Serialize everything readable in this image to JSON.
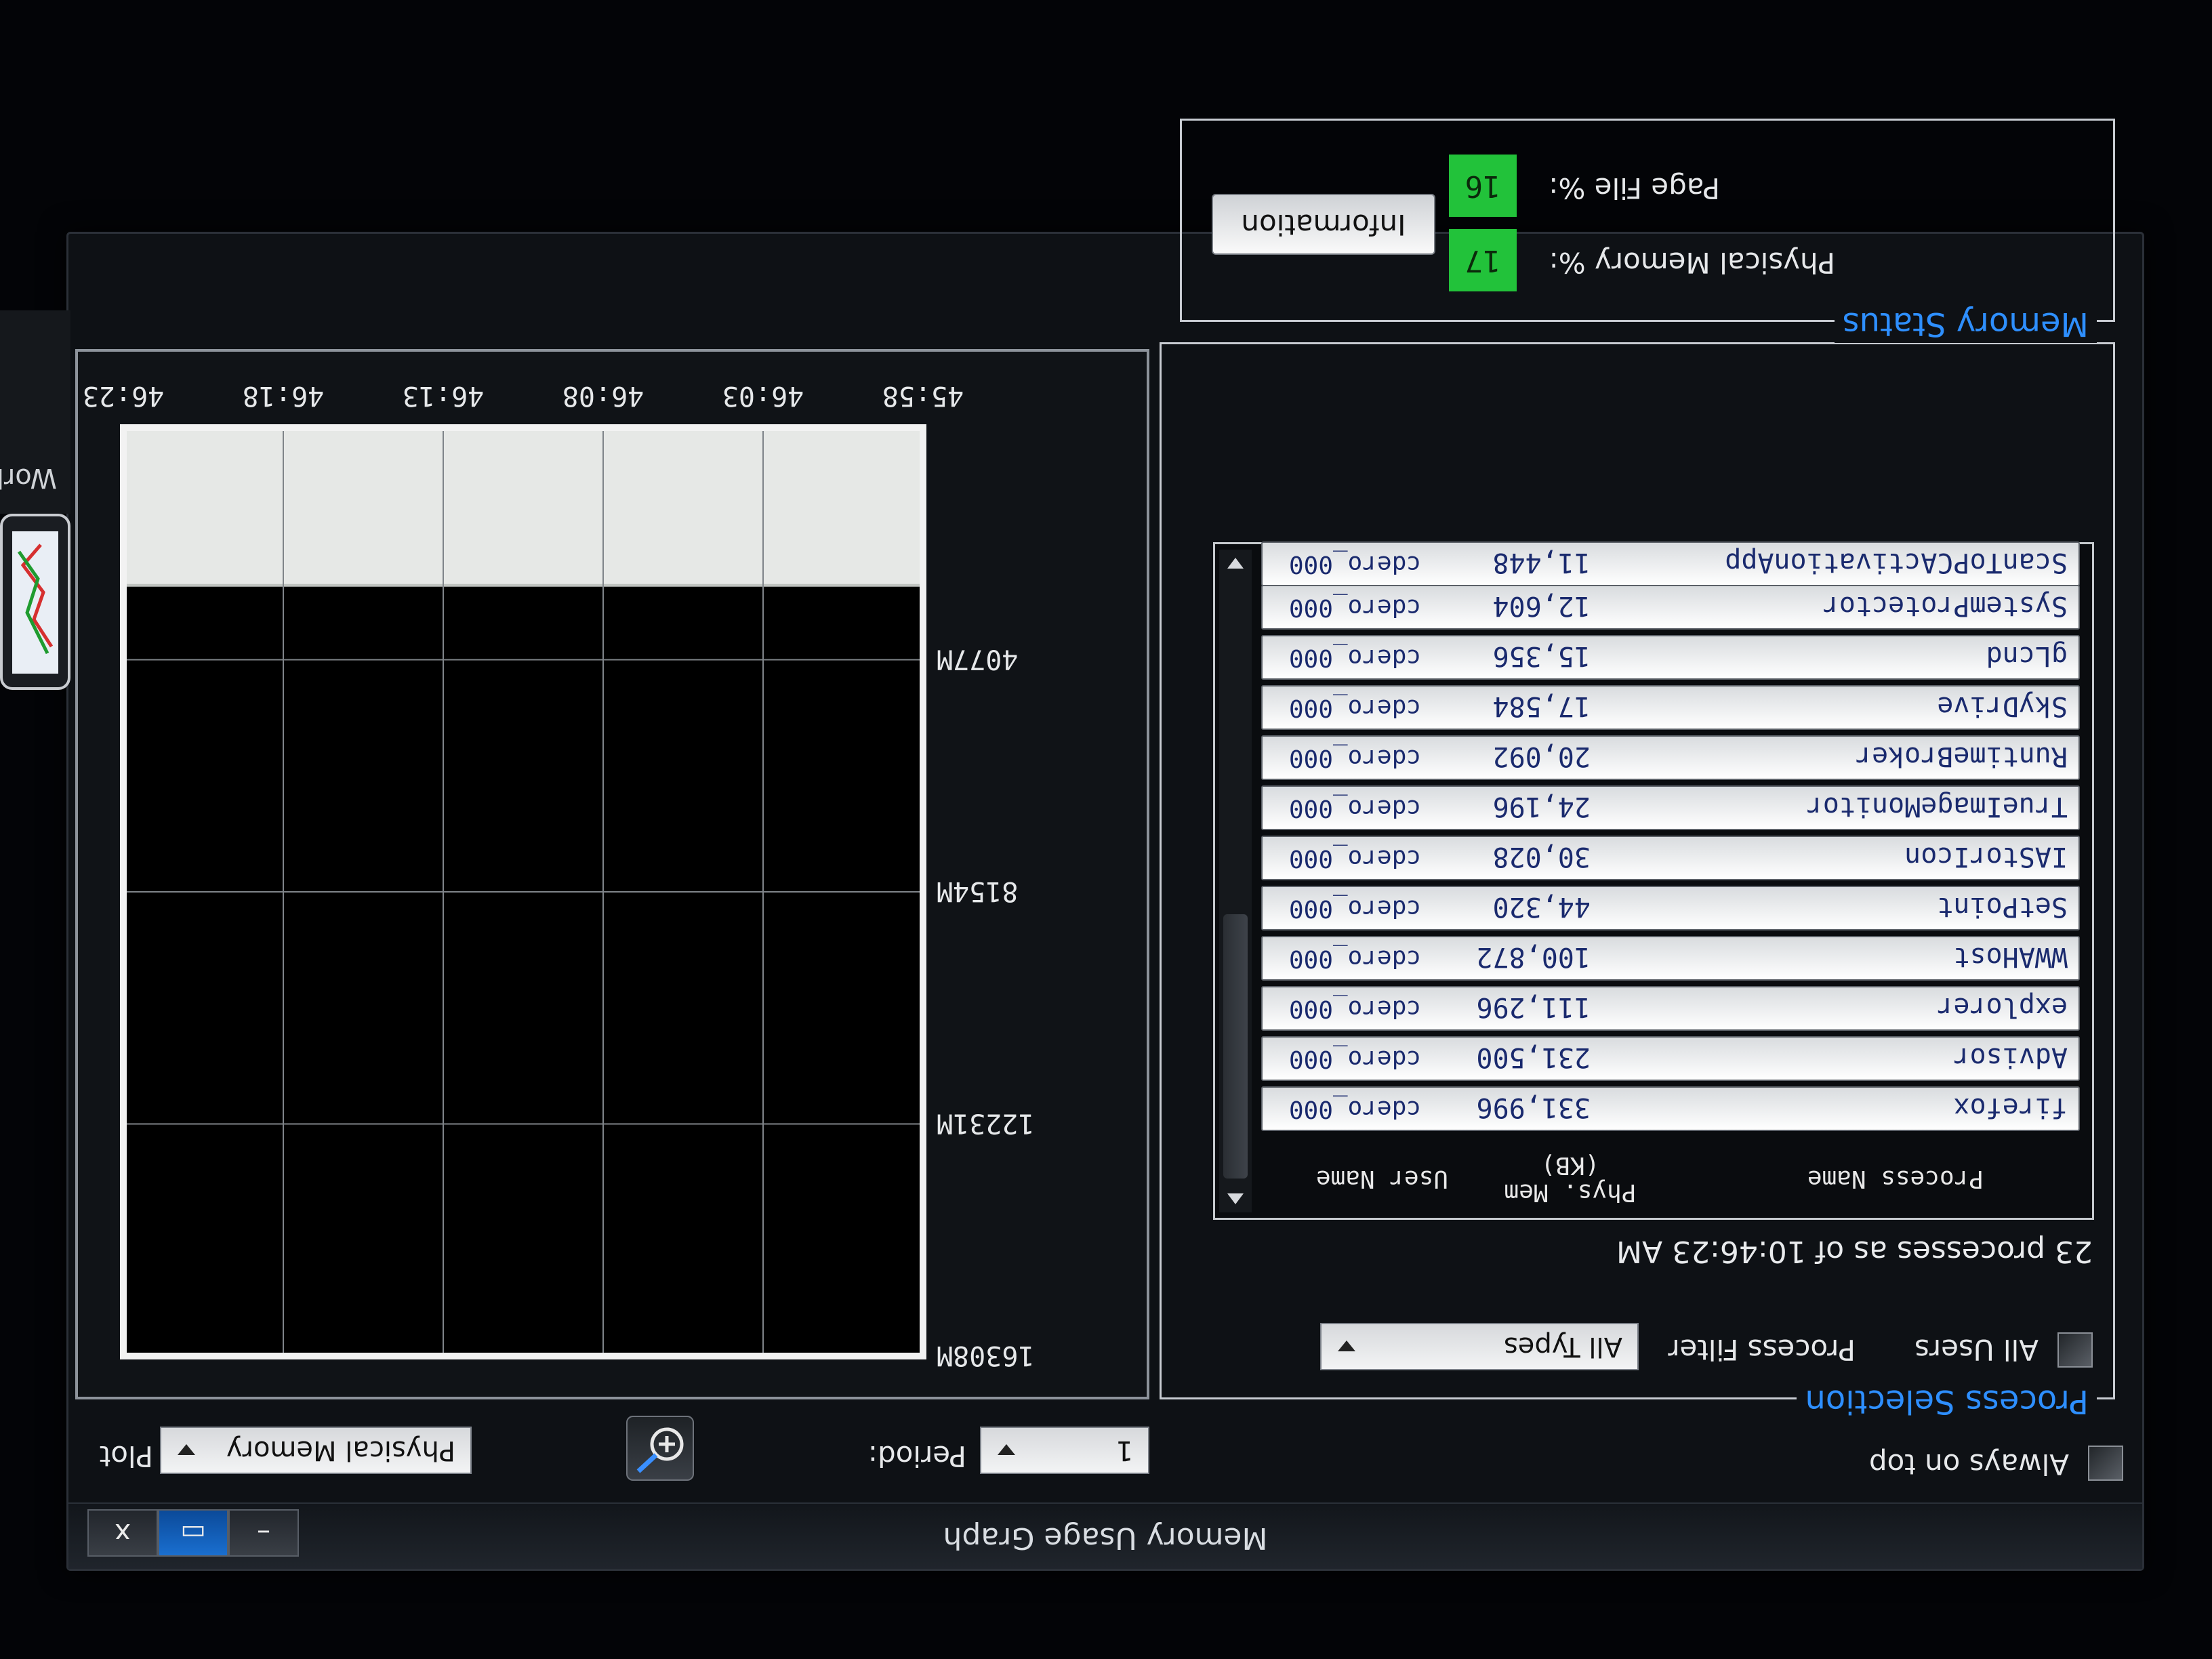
{
  "window": {
    "title": "Memory Usage Graph",
    "buttons": {
      "minimize": "–",
      "maximize": "▭",
      "close": "x"
    },
    "always_on_top_label": "Always on top"
  },
  "process_selection": {
    "group_title": "Process Selection",
    "all_users_label": "All Users",
    "process_filter_label": "Process Filter",
    "process_filter_value": "All Types",
    "process_count_text": "23 processes as of 10:46:23 AM",
    "columns": {
      "name": "Process Name",
      "mem_line1": "Phys. Mem",
      "mem_line2": "(KB)",
      "user": "User Name"
    },
    "rows": [
      {
        "name": "firefox",
        "mem": "331,996",
        "user": "cdero_000"
      },
      {
        "name": "Advisor",
        "mem": "231,500",
        "user": "cdero_000"
      },
      {
        "name": "explorer",
        "mem": "111,296",
        "user": "cdero_000"
      },
      {
        "name": "WWAHost",
        "mem": "100,872",
        "user": "cdero_000"
      },
      {
        "name": "SetPoint",
        "mem": "44,320",
        "user": "cdero_000"
      },
      {
        "name": "IAStorIcon",
        "mem": "30,028",
        "user": "cdero_000"
      },
      {
        "name": "TrueImageMonitor",
        "mem": "24,196",
        "user": "cdero_000"
      },
      {
        "name": "RuntimeBroker",
        "mem": "20,092",
        "user": "cdero_000"
      },
      {
        "name": "SkyDrive",
        "mem": "17,584",
        "user": "cdero_000"
      },
      {
        "name": "gLcnd",
        "mem": "15,356",
        "user": "cdero_000"
      },
      {
        "name": "SystemProtector",
        "mem": "12,604",
        "user": "cdero_000"
      },
      {
        "name": "ScanToPCActivationApp",
        "mem": "11,448",
        "user": "cdero_000"
      }
    ]
  },
  "memory_status": {
    "group_title": "Memory Status",
    "physical_memory_label": "Physical Memory %:",
    "physical_memory_value": "17",
    "page_file_label": "Page File %:",
    "page_file_value": "16",
    "information_button": "Information",
    "gauge_color": "#22c23a"
  },
  "plot_controls": {
    "plot_label": "Plot",
    "plot_value": "Physical Memory",
    "period_label": "Period:",
    "period_value": "1",
    "zoom_icon": "zoom-in-icon"
  },
  "chart_data": {
    "type": "area",
    "x_tick_labels": [
      "45:58",
      "46:03",
      "46:08",
      "46:13",
      "46:18",
      "46:23"
    ],
    "y_tick_labels": [
      "4077M",
      "8154M",
      "12231M",
      "16308M"
    ],
    "ylim": [
      0,
      16308
    ],
    "series": [
      {
        "x": [
          "45:58",
          "46:03",
          "46:08",
          "46:13",
          "46:18",
          "46:23"
        ],
        "values": [
          2770,
          2770,
          2770,
          2770,
          2770,
          2770
        ]
      }
    ],
    "grid": true,
    "fill_color": "#e6e8e6"
  },
  "side_panel": {
    "partial_label": "Work"
  }
}
